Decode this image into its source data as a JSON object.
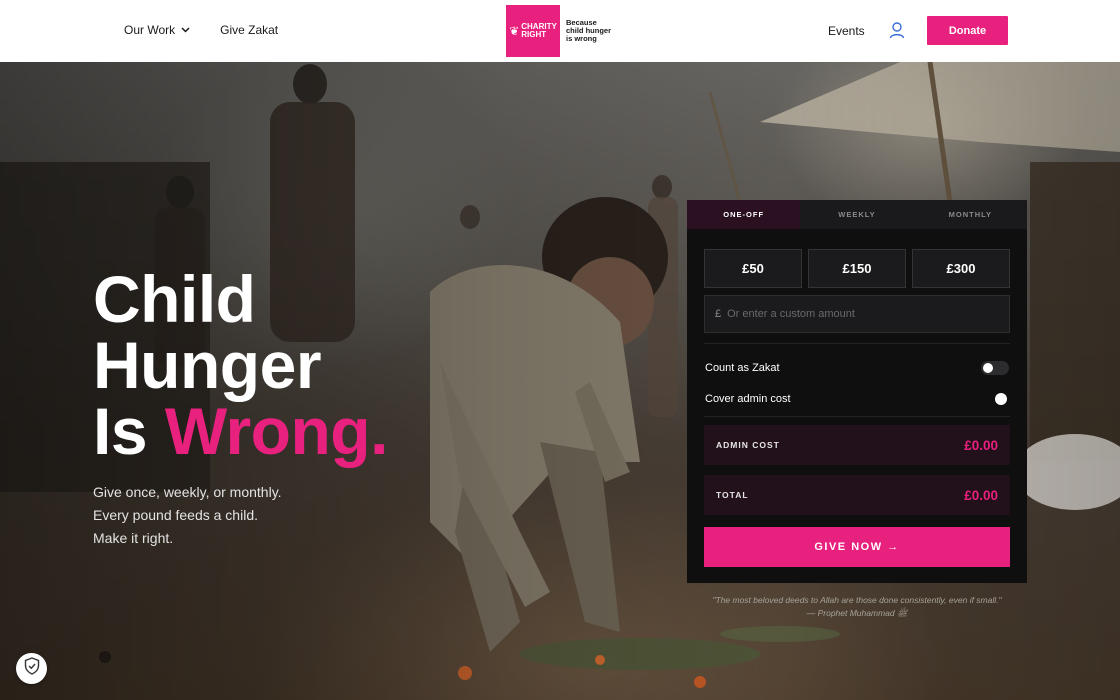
{
  "nav": {
    "our_work": "Our Work",
    "give_zakat": "Give Zakat",
    "events": "Events",
    "donate": "Donate"
  },
  "logo": {
    "line1": "CHARITY",
    "line2": "RIGHT",
    "tagline1": "Because",
    "tagline2": "child hunger",
    "tagline3": "is wrong"
  },
  "hero": {
    "line1": "Child",
    "line2": "Hunger",
    "line3_prefix": "Is",
    "line3_accent": "Wrong.",
    "sub1": "Give once, weekly, or monthly.",
    "sub2": "Every pound feeds a child.",
    "sub3": "Make it right."
  },
  "donation": {
    "tabs": [
      "ONE-OFF",
      "WEEKLY",
      "MONTHLY"
    ],
    "active_tab": "ONE-OFF",
    "amounts": [
      "£50",
      "£150",
      "£300"
    ],
    "currency_symbol": "£",
    "custom_placeholder": "Or enter a custom amount",
    "zakat_label": "Count as Zakat",
    "admin_label": "Cover admin cost",
    "admin_cost_label": "ADMIN COST",
    "admin_cost_value": "£0.00",
    "total_label": "TOTAL",
    "total_value": "£0.00",
    "give_now": "GIVE NOW →"
  },
  "quote": {
    "text": "\"The most beloved deeds to Allah are those done consistently, even if small.\"",
    "attribution": "— Prophet Muhammad ﷺ"
  },
  "colors": {
    "brand_pink": "#e8207e",
    "card_bg": "#0f0f10"
  }
}
